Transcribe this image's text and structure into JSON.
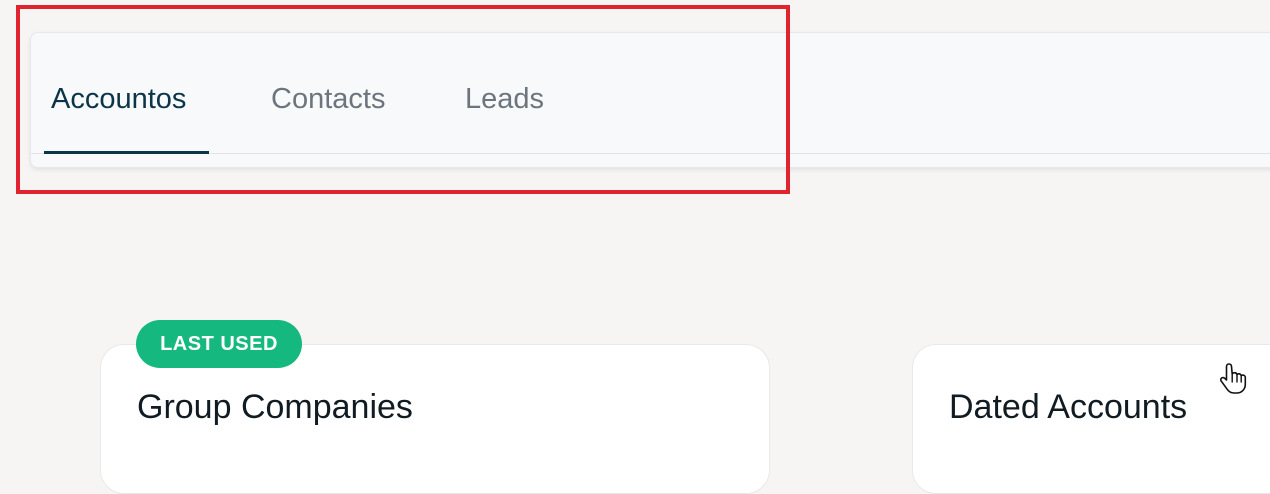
{
  "tabs": [
    {
      "label": "Accountos",
      "active": true
    },
    {
      "label": "Contacts",
      "active": false
    },
    {
      "label": "Leads",
      "active": false
    }
  ],
  "cards": [
    {
      "title": "Group Companies",
      "badge": "LAST USED"
    },
    {
      "title": "Dated Accounts"
    }
  ],
  "colors": {
    "background": "#f7f5f3",
    "tab_active": "#0b3548",
    "tab_inactive": "#6c757d",
    "badge": "#15b87f",
    "highlight": "#e0232e"
  },
  "icons": {
    "cursor": "hand-pointer-icon"
  }
}
